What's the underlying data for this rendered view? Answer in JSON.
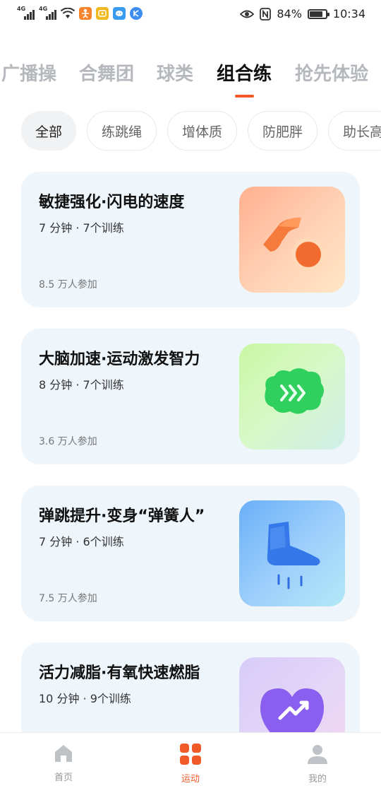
{
  "status_bar": {
    "network_1": "4G",
    "network_2": "4G",
    "app_icons": [
      "fitness-app-icon",
      "qq-browser-icon",
      "qq-chat-icon",
      "kugou-icon"
    ],
    "battery": "84%",
    "time": "10:34"
  },
  "category_tabs": [
    {
      "label": "广播操",
      "active": false
    },
    {
      "label": "合舞团",
      "active": false
    },
    {
      "label": "球类",
      "active": false
    },
    {
      "label": "组合练",
      "active": true
    },
    {
      "label": "抢先体验",
      "active": false
    }
  ],
  "filter_chips": [
    {
      "label": "全部",
      "active": true
    },
    {
      "label": "练跳绳",
      "active": false
    },
    {
      "label": "增体质",
      "active": false
    },
    {
      "label": "防肥胖",
      "active": false
    },
    {
      "label": "助长高",
      "active": false
    }
  ],
  "workouts": [
    {
      "title": "敏捷强化·闪电的速度",
      "subtitle": "7 分钟 · 7个训练",
      "participants": "8.5 万人参加",
      "icon": "hand-ball-icon"
    },
    {
      "title": "大脑加速·运动激发智力",
      "subtitle": "8 分钟 · 7个训练",
      "participants": "3.6 万人参加",
      "icon": "brain-speed-icon"
    },
    {
      "title": "弹跳提升·变身“弹簧人”",
      "subtitle": "7 分钟 · 6个训练",
      "participants": "7.5 万人参加",
      "icon": "foot-jump-icon"
    },
    {
      "title": "活力减脂·有氧快速燃脂",
      "subtitle": "10 分钟 · 9个训练",
      "participants": "",
      "icon": "heart-trend-icon"
    }
  ],
  "bottom_nav": [
    {
      "label": "首页",
      "icon": "home-icon",
      "active": false
    },
    {
      "label": "运动",
      "icon": "grid-icon",
      "active": true
    },
    {
      "label": "我的",
      "icon": "profile-icon",
      "active": false
    }
  ],
  "colors": {
    "accent": "#f05a28",
    "card_bg": "#eef5fb",
    "inactive_tab": "#b5b8bd"
  }
}
